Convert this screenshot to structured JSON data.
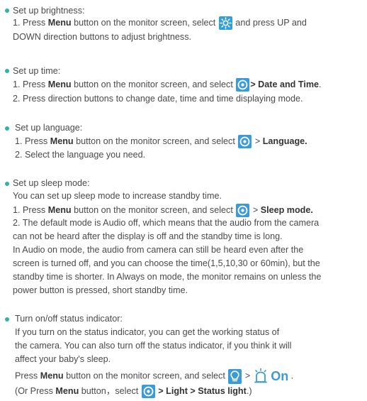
{
  "accent_color": "#2fb3a6",
  "icon_color": "#2f9fe0",
  "brightness": {
    "title": "Set up brightness:",
    "l1a": "1. Press ",
    "l1b": "Menu",
    "l1c": " button on the monitor screen, select ",
    "l1d": " and press UP and",
    "l2": "DOWN direction buttons to adjust brightness.",
    "icon": "sun-icon"
  },
  "time": {
    "title": "Set up time:",
    "l1a": "1. Press ",
    "l1b": "Menu",
    "l1c": " button on the monitor screen, and select ",
    "l1d": "> Date and Time",
    "l1e": ".",
    "l2": "2. Press direction buttons to change date, time and time displaying mode.",
    "icon": "settings-ring-icon"
  },
  "language": {
    "title": "Set up language:",
    "l1a": "1. Press ",
    "l1b": "Menu",
    "l1c": " button on the monitor screen, and select ",
    "l1d": " > ",
    "l1e": "Language.",
    "l2": "2. Select the language you need.",
    "icon": "settings-ring-icon"
  },
  "sleep": {
    "title": "Set up sleep mode:",
    "intro": "You can set up sleep mode to increase standby time.",
    "l1a": "1. Press ",
    "l1b": "Menu",
    "l1c": " button on the monitor screen, and select ",
    "l1d": " > ",
    "l1e": "Sleep mode.",
    "p1": "2. The default mode is Audio off, which means that the audio from the camera",
    "p2": "can not be heard after the display is off and the standby time is long.",
    "p3": "In Audio on mode, the audio from camera can still be heard even after the",
    "p4": "screen is turned off, and you can choose the time(1,5,10,30 or 60min), but the",
    "p5": "standby time is shorter. In Always on mode, the monitor remains on unless the",
    "p6": "power button is pressed, short standby time.",
    "icon": "settings-ring-icon"
  },
  "status": {
    "title": "Turn on/off status indicator:",
    "d1": "If you turn on the status indicator, you can get the working status of",
    "d2": "the camera. You can also turn off the status indicator, if you think it will",
    "d3": "affect your baby's sleep.",
    "l1a": "Press ",
    "l1b": "Menu",
    "l1c": " button on the monitor screen, and select ",
    "l1d": " > ",
    "on_label": "On",
    "l1f": " .",
    "l2a": "(Or Press ",
    "l2b": "Menu",
    "l2c": " button，select ",
    "l2d": " > Light > Status light",
    "l2e": ".)",
    "icons": [
      "bulb-icon",
      "light-on-icon",
      "settings-ring-icon"
    ]
  }
}
